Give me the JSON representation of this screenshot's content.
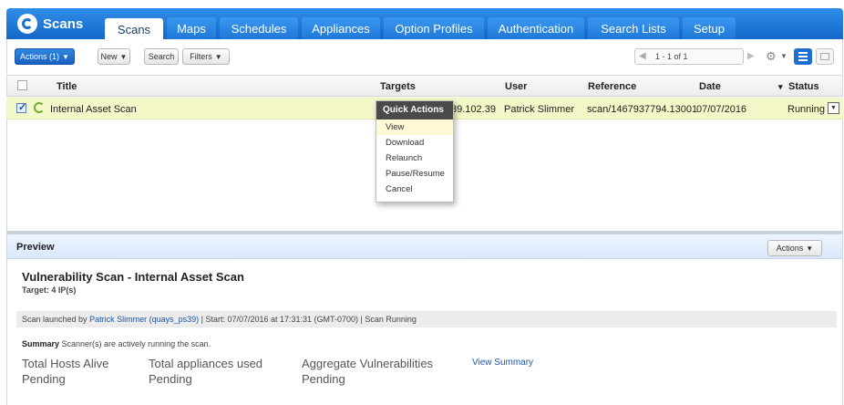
{
  "nav": {
    "brand": "Scans",
    "tabs": [
      "Scans",
      "Maps",
      "Schedules",
      "Appliances",
      "Option Profiles",
      "Authentication",
      "Search Lists",
      "Setup"
    ],
    "active_tab": "Scans"
  },
  "toolbar": {
    "actions_label": "Actions (1)",
    "new_label": "New",
    "search_label": "Search",
    "filters_label": "Filters",
    "pager_range": "1 - 1 of 1"
  },
  "table": {
    "columns": [
      "Title",
      "Targets",
      "User",
      "Reference",
      "Date",
      "Status"
    ],
    "rows": [
      {
        "title": "Internal Asset Scan",
        "targets": "39.102.39",
        "user": "Patrick Slimmer",
        "reference": "scan/1467937794.13001",
        "date": "07/07/2016",
        "status": "Running"
      }
    ]
  },
  "quick_actions": {
    "title": "Quick Actions",
    "items": [
      "View",
      "Download",
      "Relaunch",
      "Pause/Resume",
      "Cancel"
    ]
  },
  "preview": {
    "bar_title": "Preview",
    "actions_label": "Actions",
    "heading": "Vulnerability Scan - Internal Asset Scan",
    "target": "Target: 4 IP(s)",
    "launch_prefix": "Scan launched by ",
    "launch_user": "Patrick Slimmer (quays_ps39)",
    "launch_suffix": "  |  Start: 07/07/2016 at 17:31:31 (GMT-0700)  |  Scan Running",
    "summary_label": "Summary",
    "summary_text": " Scanner(s) are actively running the scan.",
    "stats": [
      {
        "label": "Total Hosts Alive",
        "value": "Pending"
      },
      {
        "label": "Total appliances used",
        "value": "Pending"
      },
      {
        "label": "Aggregate Vulnerabilities",
        "value": "Pending"
      }
    ],
    "view_summary": "View Summary"
  },
  "colors": {
    "nav_blue": "#1d6fd2",
    "selected_row": "#f4f7c8",
    "link": "#1a56b0"
  }
}
